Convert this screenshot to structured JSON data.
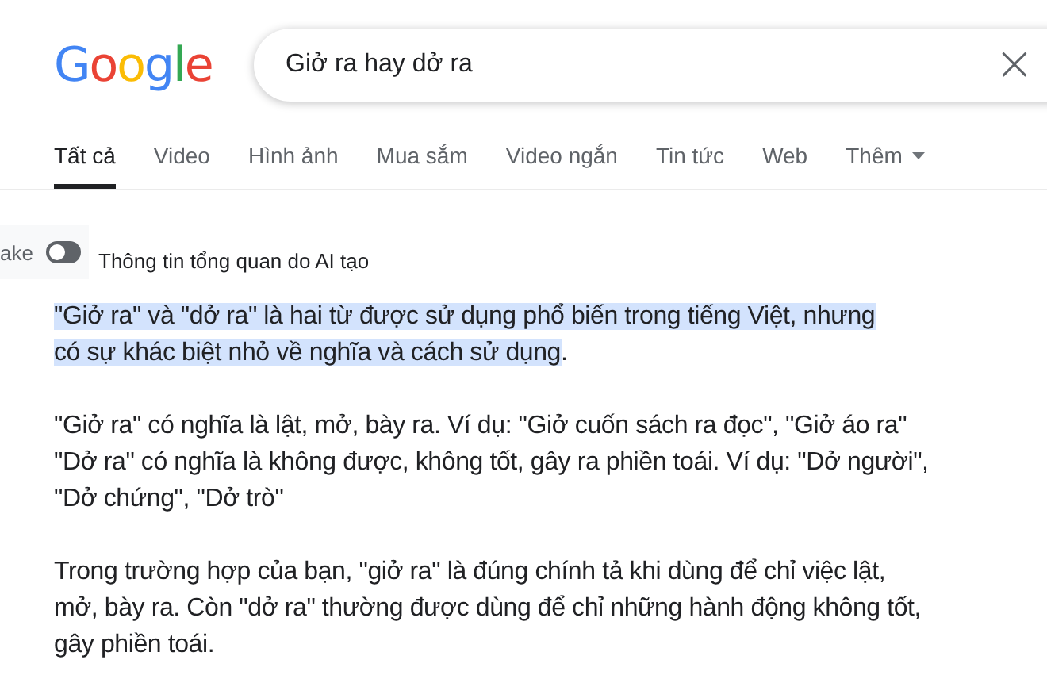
{
  "logo": "Google",
  "search": {
    "value": "Giở ra hay dở ra",
    "clear": "×"
  },
  "tabs": [
    {
      "label": "Tất cả",
      "selected": true
    },
    {
      "label": "Video",
      "selected": false
    },
    {
      "label": "Hình ảnh",
      "selected": false
    },
    {
      "label": "Mua sắm",
      "selected": false
    },
    {
      "label": "Video ngắn",
      "selected": false
    },
    {
      "label": "Tin tức",
      "selected": false
    },
    {
      "label": "Web",
      "selected": false
    },
    {
      "label": "Thêm",
      "selected": false,
      "dropdown": true
    }
  ],
  "overview": {
    "side_label": "ake",
    "toggle_on": false,
    "title": "Thông tin tổng quan do AI tạo"
  },
  "paragraphs": [
    {
      "highlighted": true,
      "lines": [
        "\"Giở ra\" và \"dở ra\" là hai từ được sử dụng phổ biến trong tiếng Việt, nhưng",
        "có sự khác biệt nhỏ về nghĩa và cách sử dụng"
      ],
      "tail": "."
    },
    {
      "highlighted": false,
      "lines": [
        "\"Giở ra\" có nghĩa là lật, mở, bày ra. Ví dụ: \"Giở cuốn sách ra đọc\", \"Giở áo ra\"",
        "\"Dở ra\" có nghĩa là không được, không tốt, gây ra phiền toái. Ví dụ: \"Dở người\",",
        "\"Dở chứng\", \"Dở trò\""
      ]
    },
    {
      "highlighted": false,
      "lines": [
        "Trong trường hợp của bạn, \"giở ra\" là đúng chính tả khi dùng để chỉ việc lật,",
        "mở, bày ra. Còn \"dở ra\" thường được dùng để chỉ những hành động không tốt,",
        "gây phiền toái."
      ]
    }
  ]
}
